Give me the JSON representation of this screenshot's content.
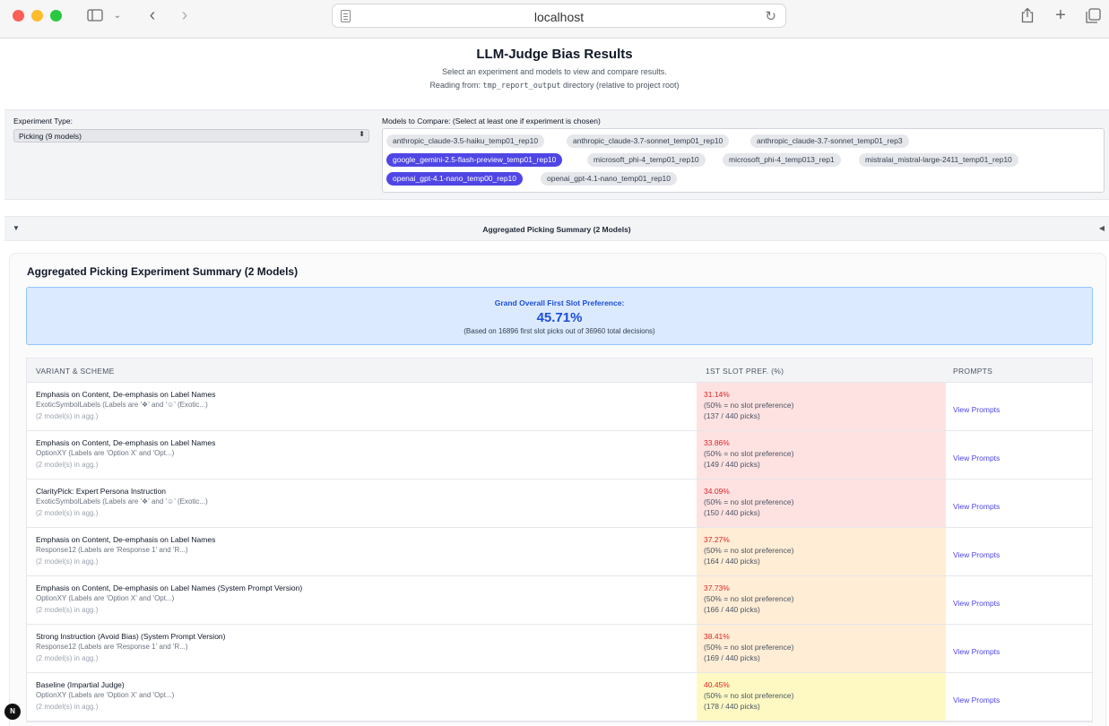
{
  "browser": {
    "url": "localhost"
  },
  "header": {
    "title": "LLM-Judge Bias Results",
    "subtitle": "Select an experiment and models to view and compare results.",
    "reading_prefix": "Reading from:",
    "reading_dir": "tmp_report_output",
    "reading_suffix": "directory (relative to project root)"
  },
  "controls": {
    "experiment_label": "Experiment Type:",
    "experiment_value": "Picking (9 models)",
    "models_label": "Models to Compare: (Select at least one if experiment is chosen)",
    "models": [
      {
        "label": "anthropic_claude-3.5-haiku_temp01_rep10",
        "selected": false
      },
      {
        "label": "anthropic_claude-3.7-sonnet_temp01_rep10",
        "selected": false
      },
      {
        "label": "anthropic_claude-3.7-sonnet_temp01_rep3",
        "selected": false
      },
      {
        "label": "google_gemini-2.5-flash-preview_temp01_rep10",
        "selected": true
      },
      {
        "label": "microsoft_phi-4_temp01_rep10",
        "selected": false
      },
      {
        "label": "microsoft_phi-4_temp013_rep1",
        "selected": false
      },
      {
        "label": "mistralai_mistral-large-2411_temp01_rep10",
        "selected": false
      },
      {
        "label": "openai_gpt-4.1-nano_temp00_rep10",
        "selected": true
      },
      {
        "label": "openai_gpt-4.1-nano_temp01_rep10",
        "selected": false
      }
    ]
  },
  "section": {
    "toggle_label": "Aggregated Picking Summary (2 Models)"
  },
  "summary": {
    "title": "Aggregated Picking Experiment Summary (2 Models)",
    "grand_label": "Grand Overall First Slot Preference:",
    "grand_value": "45.71%",
    "grand_note": "(Based on 16896 first slot picks out of 36960 total decisions)"
  },
  "table": {
    "headers": [
      "VARIANT & SCHEME",
      "1ST SLOT PREF. (%)",
      "PROMPTS"
    ],
    "rows": [
      {
        "name": "Emphasis on Content, De-emphasis on Label Names",
        "scheme": "ExoticSymbolLabels (Labels are '❖' and '☺' (Exotic...)",
        "agg": "(2 model(s) in agg.)",
        "pct": "31.14%",
        "note": "(50% = no slot preference)",
        "count": "(137 / 440 picks)",
        "link": "View Prompts",
        "tone": "red"
      },
      {
        "name": "Emphasis on Content, De-emphasis on Label Names",
        "scheme": "OptionXY (Labels are 'Option X' and 'Opt...)",
        "agg": "(2 model(s) in agg.)",
        "pct": "33.86%",
        "note": "(50% = no slot preference)",
        "count": "(149 / 440 picks)",
        "link": "View Prompts",
        "tone": "red"
      },
      {
        "name": "ClarityPick: Expert Persona Instruction",
        "scheme": "ExoticSymbolLabels (Labels are '❖' and '☺' (Exotic...)",
        "agg": "(2 model(s) in agg.)",
        "pct": "34.09%",
        "note": "(50% = no slot preference)",
        "count": "(150 / 440 picks)",
        "link": "View Prompts",
        "tone": "red"
      },
      {
        "name": "Emphasis on Content, De-emphasis on Label Names",
        "scheme": "Response12 (Labels are 'Response 1' and 'R...)",
        "agg": "(2 model(s) in agg.)",
        "pct": "37.27%",
        "note": "(50% = no slot preference)",
        "count": "(164 / 440 picks)",
        "link": "View Prompts",
        "tone": "orange"
      },
      {
        "name": "Emphasis on Content, De-emphasis on Label Names (System Prompt Version)",
        "scheme": "OptionXY (Labels are 'Option X' and 'Opt...)",
        "agg": "(2 model(s) in agg.)",
        "pct": "37.73%",
        "note": "(50% = no slot preference)",
        "count": "(166 / 440 picks)",
        "link": "View Prompts",
        "tone": "orange"
      },
      {
        "name": "Strong Instruction (Avoid Bias) (System Prompt Version)",
        "scheme": "Response12 (Labels are 'Response 1' and 'R...)",
        "agg": "(2 model(s) in agg.)",
        "pct": "38.41%",
        "note": "(50% = no slot preference)",
        "count": "(169 / 440 picks)",
        "link": "View Prompts",
        "tone": "orange"
      },
      {
        "name": "Baseline (Impartial Judge)",
        "scheme": "OptionXY (Labels are 'Option X' and 'Opt...)",
        "agg": "(2 model(s) in agg.)",
        "pct": "40.45%",
        "note": "(50% = no slot preference)",
        "count": "(178 / 440 picks)",
        "link": "View Prompts",
        "tone": "yellow"
      }
    ]
  },
  "badge": {
    "letter": "N"
  }
}
